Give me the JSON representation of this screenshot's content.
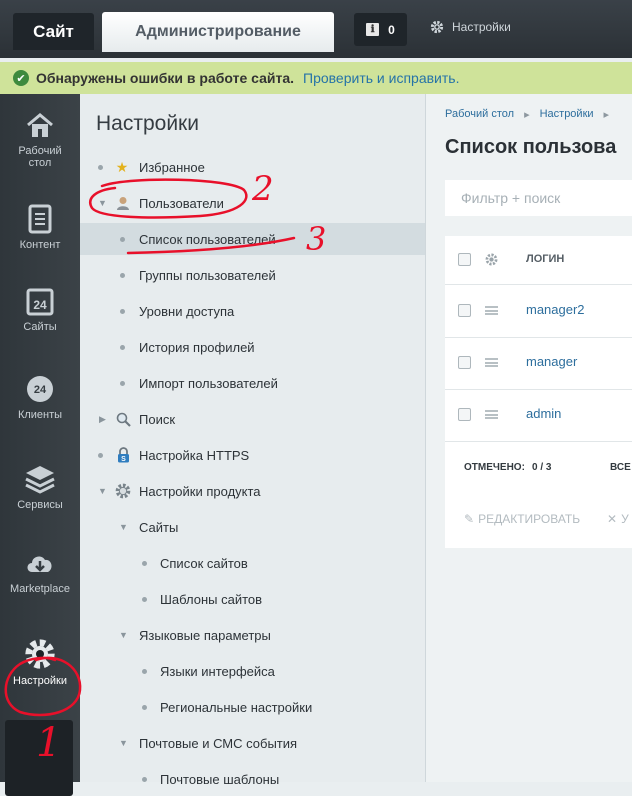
{
  "topbar": {
    "site_tab": "Сайт",
    "admin_tab": "Администрирование",
    "notifications_count": "0",
    "settings_label": "Настройки"
  },
  "alert": {
    "message": "Обнаружены ошибки в работе сайта.",
    "link": "Проверить и исправить."
  },
  "rail": {
    "items": [
      {
        "label_line1": "Рабочий",
        "label_line2": "стол",
        "icon": "home-icon"
      },
      {
        "label_line1": "Контент",
        "icon": "document-icon"
      },
      {
        "label_line1": "Сайты",
        "icon": "calendar-24-icon"
      },
      {
        "label_line1": "Клиенты",
        "icon": "clients-24-icon"
      },
      {
        "label_line1": "Сервисы",
        "icon": "layers-icon"
      },
      {
        "label_line1": "Marketplace",
        "icon": "cloud-download-icon"
      },
      {
        "label_line1": "Настройки",
        "icon": "gear-icon"
      }
    ]
  },
  "panel": {
    "title": "Настройки",
    "items": [
      {
        "label": "Избранное"
      },
      {
        "label": "Пользователи"
      },
      {
        "label": "Список пользователей"
      },
      {
        "label": "Группы пользователей"
      },
      {
        "label": "Уровни доступа"
      },
      {
        "label": "История профилей"
      },
      {
        "label": "Импорт пользователей"
      },
      {
        "label": "Поиск"
      },
      {
        "label": "Настройка HTTPS"
      },
      {
        "label": "Настройки продукта"
      },
      {
        "label": "Сайты"
      },
      {
        "label": "Список сайтов"
      },
      {
        "label": "Шаблоны сайтов"
      },
      {
        "label": "Языковые параметры"
      },
      {
        "label": "Языки интерфейса"
      },
      {
        "label": "Региональные настройки"
      },
      {
        "label": "Почтовые и СМС события"
      },
      {
        "label": "Почтовые шаблоны"
      }
    ]
  },
  "content": {
    "breadcrumb": [
      "Рабочий стол",
      "Настройки"
    ],
    "title": "Список пользова",
    "filter_placeholder": "Фильтр + поиск",
    "column_login": "ЛОГИН",
    "rows": [
      "manager2",
      "manager",
      "admin"
    ],
    "footer_selected_label": "ОТМЕЧЕНО:",
    "footer_selected_value": "0 / 3",
    "footer_all": "ВСЕ",
    "edit_label": "РЕДАКТИРОВАТЬ",
    "delete_label": "У"
  },
  "annotations": [
    "1",
    "2",
    "3"
  ],
  "colors": {
    "annotation": "#e8102a",
    "alert_bg": "#cfe39a",
    "link": "#2573a8"
  }
}
